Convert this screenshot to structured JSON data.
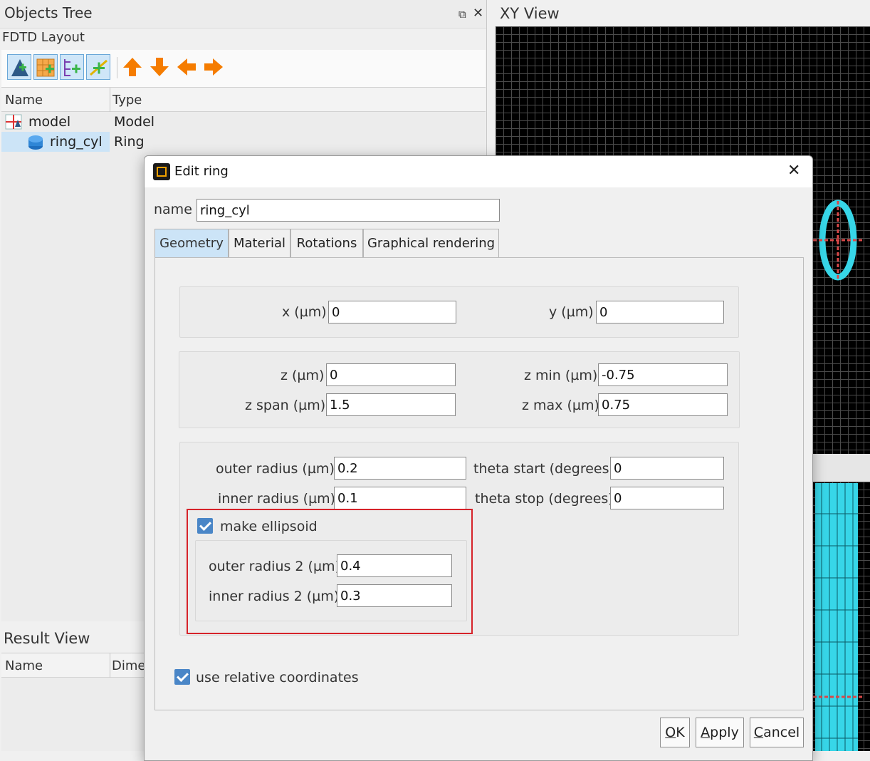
{
  "objects_tree": {
    "title": "Objects Tree",
    "layout_label": "FDTD Layout",
    "columns": [
      "Name",
      "Type"
    ],
    "rows": [
      {
        "name": "model",
        "type": "Model",
        "icon": "model-icon"
      },
      {
        "name": "ring_cyl",
        "type": "Ring",
        "icon": "ring-icon",
        "selected": true
      }
    ],
    "toolbar_icons": [
      "add-structure-icon",
      "add-grid-icon",
      "add-monitor-icon",
      "add-source-icon",
      "move-up-icon",
      "move-down-icon",
      "move-left-icon",
      "move-right-icon"
    ]
  },
  "result_view": {
    "title": "Result View",
    "columns": [
      "Name",
      "Dime"
    ]
  },
  "xy_view": {
    "title": "XY View",
    "colors": {
      "structure": "#37d6e8",
      "mesh_marker": "#d94848",
      "grid_line": "#4b4b4b"
    }
  },
  "dialog": {
    "title": "Edit ring",
    "name_label": "name",
    "name_value": "ring_cyl",
    "tabs": [
      "Geometry",
      "Material",
      "Rotations",
      "Graphical rendering"
    ],
    "active_tab": "Geometry",
    "geometry": {
      "x_label": "x (µm)",
      "x_value": "0",
      "y_label": "y (µm)",
      "y_value": "0",
      "z_label": "z (µm)",
      "z_value": "0",
      "z_span_label": "z span (µm)",
      "z_span_value": "1.5",
      "z_min_label": "z min (µm)",
      "z_min_value": "-0.75",
      "z_max_label": "z max (µm)",
      "z_max_value": "0.75",
      "outer_radius_label": "outer radius (µm)",
      "outer_radius_value": "0.2",
      "inner_radius_label": "inner radius (µm)",
      "inner_radius_value": "0.1",
      "theta_start_label": "theta start (degrees)",
      "theta_start_value": "0",
      "theta_stop_label": "theta stop (degrees)",
      "theta_stop_value": "0",
      "make_ellipsoid_label": "make ellipsoid",
      "make_ellipsoid_checked": true,
      "outer_radius2_label": "outer radius 2 (µm)",
      "outer_radius2_value": "0.4",
      "inner_radius2_label": "inner radius 2 (µm)",
      "inner_radius2_value": "0.3",
      "relative_coords_label": "use relative coordinates",
      "relative_coords_checked": true
    },
    "buttons": {
      "ok": {
        "first": "O",
        "rest": "K"
      },
      "apply": {
        "first": "A",
        "rest": "pply"
      },
      "cancel": {
        "first": "C",
        "rest": "ancel"
      }
    },
    "highlight_color": "#d6232a"
  }
}
